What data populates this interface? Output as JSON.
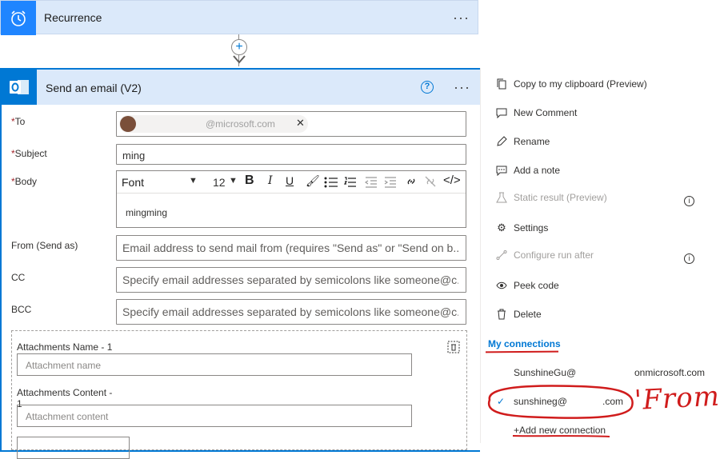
{
  "recurrence": {
    "title": "Recurrence",
    "more": "···",
    "icon": "alarm-clock-icon"
  },
  "connector": {
    "add": "+"
  },
  "email_card": {
    "title": "Send an email (V2)",
    "help": "?",
    "more": "···",
    "icon": "outlook-icon",
    "fields": {
      "to": {
        "label": "To",
        "required": "*",
        "token_text": "@microsoft.com",
        "token_remove": "✕"
      },
      "subject": {
        "label": "Subject",
        "required": "*",
        "value": "ming"
      },
      "body": {
        "label": "Body",
        "required": "*",
        "font": "Font",
        "size": "12",
        "value": "mingming"
      },
      "from": {
        "label": "From (Send as)",
        "placeholder": "Email address to send mail from (requires \"Send as\" or \"Send on b..."
      },
      "cc": {
        "label": "CC",
        "placeholder": "Specify email addresses separated by semicolons like someone@c..."
      },
      "bcc": {
        "label": "BCC",
        "placeholder": "Specify email addresses separated by semicolons like someone@c..."
      }
    },
    "attachments": {
      "name_label": "Attachments Name - 1",
      "name_placeholder": "Attachment name",
      "content_label": "Attachments Content -",
      "content_label_2": "1",
      "content_placeholder": "Attachment content"
    }
  },
  "menu": {
    "items": [
      {
        "label": "Copy to my clipboard (Preview)",
        "icon": "copy-icon",
        "enabled": true
      },
      {
        "label": "New Comment",
        "icon": "comment-icon",
        "enabled": true
      },
      {
        "label": "Rename",
        "icon": "pencil-icon",
        "enabled": true
      },
      {
        "label": "Add a note",
        "icon": "note-icon",
        "enabled": true
      },
      {
        "label": "Static result (Preview)",
        "icon": "flask-icon",
        "enabled": false
      },
      {
        "label": "Settings",
        "icon": "gear-icon",
        "enabled": true
      },
      {
        "label": "Configure run after",
        "icon": "run-after-icon",
        "enabled": false
      },
      {
        "label": "Peek code",
        "icon": "eye-icon",
        "enabled": true
      },
      {
        "label": "Delete",
        "icon": "trash-icon",
        "enabled": true
      }
    ],
    "info": "i",
    "my_connections": "My connections",
    "connections": [
      {
        "user": "SunshineGu@",
        "domain": "onmicrosoft.com",
        "selected": false
      },
      {
        "user": "sunshineg@",
        "domain": ".com",
        "selected": true
      }
    ],
    "check": "✓",
    "add_connection": "+Add new connection"
  },
  "annotation": {
    "text": "'From'",
    "color": "#d01c1c"
  },
  "colors": {
    "accent": "#0078d4",
    "header_bg": "#dbe9fa",
    "annotation": "#d01c1c"
  }
}
